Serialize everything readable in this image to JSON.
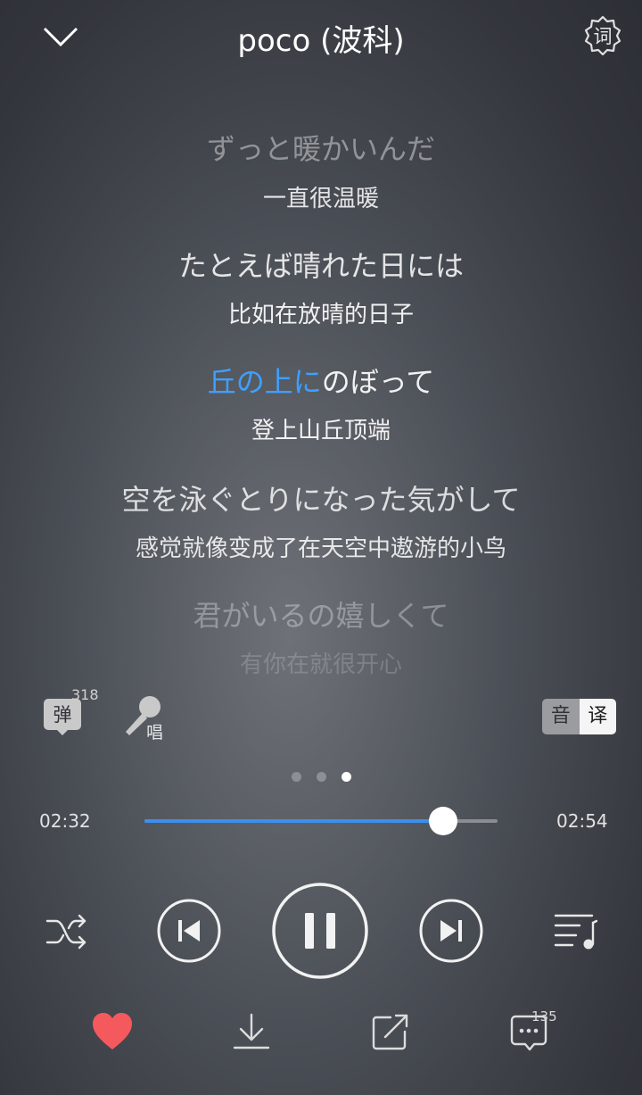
{
  "header": {
    "title": "poco (波科)",
    "lyric_settings_glyph": "词"
  },
  "lyrics": [
    {
      "jp": "ずっと暖かいんだ",
      "cn": "一直很温暖"
    },
    {
      "jp": "たとえば晴れた日には",
      "cn": "比如在放晴的日子"
    },
    {
      "jp_sung": "丘の上に",
      "jp_rest": "のぼって",
      "cn": "登上山丘顶端"
    },
    {
      "jp": "空を泳ぐとりになった気がして",
      "cn": "感觉就像变成了在天空中遨游的小鸟"
    },
    {
      "jp": "君がいるの嬉しくて",
      "cn": "有你在就很开心"
    }
  ],
  "tools": {
    "danmu_label": "弹",
    "danmu_count": "318",
    "sing_label": "唱",
    "toggle": {
      "phonetic": "音",
      "translate": "译"
    }
  },
  "pager": {
    "pages": 3,
    "active": 3
  },
  "player": {
    "current_time": "02:32",
    "total_time": "02:54",
    "progress": 0.845,
    "state": "playing"
  },
  "actions": {
    "comment_count": "135"
  },
  "icons": [
    "chevron-down-icon",
    "lyric-settings-icon",
    "danmu-icon",
    "microphone-icon",
    "shuffle-icon",
    "previous-icon",
    "pause-icon",
    "next-icon",
    "playlist-icon",
    "heart-icon",
    "download-icon",
    "share-icon",
    "comment-icon"
  ],
  "colors": {
    "accent": "#3ea0ff",
    "progress": "#3b8ff0",
    "heart": "#f4595e"
  }
}
